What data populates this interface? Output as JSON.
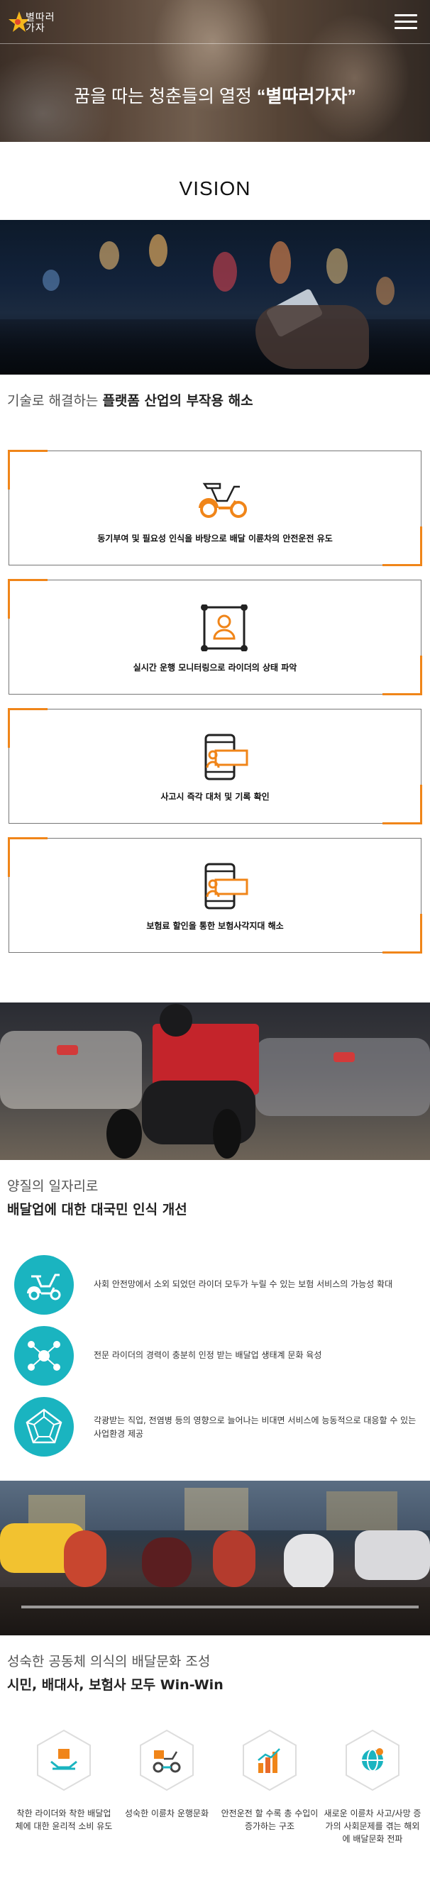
{
  "header": {
    "logo_text": "별따러\n가자",
    "hero_prefix": "꿈을 따는 청춘들의 열정 ",
    "hero_highlight": "“별따러가자”"
  },
  "vision": {
    "title": "VISION",
    "heading_light": "기술로 해결하는 ",
    "heading_bold": "플랫폼 산업의 부작용 해소",
    "cards": [
      {
        "label": "동기부여 및 필요성 인식을 바탕으로 배달 이륜차의 안전운전 유도",
        "icon": "scooter-icon"
      },
      {
        "label": "실시간 운행 모니터링으로 라이더의 상태 파악",
        "icon": "monitoring-icon"
      },
      {
        "label": "사고시 즉각 대처 및 기록 확인",
        "icon": "phone-record-icon"
      },
      {
        "label": "보험료 할인을 통한 보험사각지대 해소",
        "icon": "phone-discount-icon"
      }
    ]
  },
  "jobs": {
    "line1": "양질의 일자리로",
    "line2": "배달업에 대한 대국민 인식 개선",
    "items": [
      {
        "text": "사회 안전망에서 소외 되었던 라이더 모두가 누릴 수 있는 보험 서비스의 가능성 확대",
        "icon": "scooter-icon"
      },
      {
        "text": "전문 라이더의 경력이 충분히 인정 받는 배달업 생태계 문화 육성",
        "icon": "network-icon"
      },
      {
        "text": "각광받는 직업, 전염병 등의 영향으로 늘어나는 비대면 서비스에 능동적으로 대응할 수 있는 사업환경 제공",
        "icon": "pentagon-icon"
      }
    ]
  },
  "community": {
    "line1": "성숙한 공동체 의식의 배달문화 조성",
    "line2": "시민, 배대사, 보험사 모두 Win-Win",
    "items": [
      {
        "text": "착한 라이더와 착한 배달업체에 대한 윤리적 소비 유도",
        "icon": "hands-box-icon"
      },
      {
        "text": "성숙한 이륜차 운행문화",
        "icon": "scooter-icon"
      },
      {
        "text": "안전운전 할 수록 총 수입이 증가하는 구조",
        "icon": "bar-chart-icon"
      },
      {
        "text": "새로운 이륜차 사고/사망 증가의 사회문제를 겪는 해외에 배달문화 전파",
        "icon": "globe-icon"
      }
    ]
  },
  "colors": {
    "accent_orange": "#f08519",
    "teal": "#1ab4c0",
    "hex_gray": "#dddddd"
  }
}
